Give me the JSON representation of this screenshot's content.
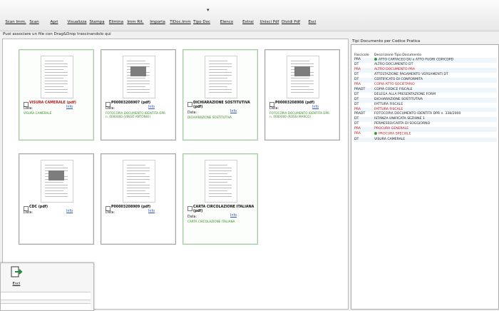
{
  "toolbar": {
    "buttons": [
      {
        "label": "Scan Imm.",
        "icon": "scanner-icon",
        "color": "#4b6b8a"
      },
      {
        "label": "Scan",
        "icon": "scan-icon",
        "color": "#4b6b8a"
      },
      {
        "label": "Apri",
        "icon": "folder-icon",
        "color": "#e8b23a"
      },
      {
        "label": "Visualizza",
        "icon": "view-icon",
        "color": "#4a8a4a"
      },
      {
        "label": "Stampa",
        "icon": "printer-icon",
        "color": "#5a5a5a"
      },
      {
        "label": "Elimina",
        "icon": "delete-icon",
        "color": "#d22b2b"
      },
      {
        "label": "Imm Rit.",
        "icon": "image-crop-icon",
        "color": "#3a7ab0"
      },
      {
        "label": "Importa",
        "icon": "import-icon",
        "color": "#2f8a3a"
      },
      {
        "label": "TiDoc.Imm",
        "icon": "doc-type-image-icon",
        "color": "#3e9a3e"
      },
      {
        "label": "Tipo Doc",
        "icon": "doc-type-icon",
        "color": "#3e9a3e"
      },
      {
        "label": "Elenco",
        "icon": "list-icon",
        "color": "#2e64b5"
      },
      {
        "label": "Estrai",
        "icon": "extract-icon",
        "color": "#d98a2a"
      },
      {
        "label": "Unisci Pdf",
        "icon": "merge-pdf-icon",
        "color": "#c42424"
      },
      {
        "label": "Dividi Pdf",
        "icon": "split-pdf-icon",
        "color": "#c42424"
      },
      {
        "label": "Esci",
        "icon": "exit-icon",
        "color": "#1f8a3a"
      }
    ],
    "dropdown_glyph": "▾"
  },
  "hint": "Puoi associare un file con Drag&Drop trascinandolo qui",
  "cards": [
    {
      "name": "VISURA CAMERALE (pdf)",
      "date_label": "Data:",
      "info": "Info",
      "desc": [
        "VISURA CAMERALE"
      ],
      "selected": true,
      "red": true
    },
    {
      "name": "P00003208907 (pdf)",
      "date_label": "Data:",
      "info": "Info",
      "desc": [
        "FOTOCOPIA DOCUMENTO IDENTITA DPR",
        "n. 0000000 (VIRGO ANTONIO)"
      ],
      "selected": false,
      "red": false
    },
    {
      "name": "DICHIARAZIONE SOSTITUTIVA (pdf)",
      "date_label": "Data:",
      "info": "Info",
      "desc": [
        "DICHIARAZIONE SOSTITUTIVA"
      ],
      "selected": true,
      "red": false
    },
    {
      "name": "P00003208908 (pdf)",
      "date_label": "Data:",
      "info": "Info",
      "desc": [
        "FOTOCOPIA DOCUMENTO IDENTITA DPR",
        "n. 0000000 (ROSSI MARCO)"
      ],
      "selected": false,
      "red": false
    },
    {
      "name": "CDC (pdf)",
      "date_label": "Data:",
      "info": "Info",
      "desc": [],
      "selected": false,
      "red": false
    },
    {
      "name": "P00003208909 (pdf)",
      "date_label": "Data:",
      "info": "Info",
      "desc": [],
      "selected": false,
      "red": false
    },
    {
      "name": "CARTA CIRCOLAZIONE ITALIANA (pdf)",
      "date_label": "Data:",
      "info": "Info",
      "desc": [
        "CARTA CIRCOLAZIONE ITALIANA"
      ],
      "selected": true,
      "red": false
    }
  ],
  "side": {
    "title": "Tipi Documento per Codice Pratica",
    "headers": [
      "Fascicolo",
      "Descrizione Tipo Documento"
    ],
    "rows": [
      {
        "code": "PRA",
        "desc": "ATTO CARTACEO DU o ATTO FUORI CDP/CDPD",
        "red": false,
        "dot": true
      },
      {
        "code": "DT",
        "desc": "ALTRO DOCUMENTO DT",
        "red": false,
        "dot": false
      },
      {
        "code": "PRA",
        "desc": "ALTRO DOCUMENTO PRA",
        "red": true,
        "dot": false
      },
      {
        "code": "DT",
        "desc": "ATTESTAZIONE PAGAMENTO VERSAMENTI DT",
        "red": false,
        "dot": false
      },
      {
        "code": "DT",
        "desc": "CERTIFICATO DI CONFORMITA",
        "red": false,
        "dot": false
      },
      {
        "code": "PRA",
        "desc": "COPIA ATTO SOCIETARIO",
        "red": true,
        "dot": false
      },
      {
        "code": "PRADT",
        "desc": "COPIA CODICE FISCALE",
        "red": false,
        "dot": false
      },
      {
        "code": "DT",
        "desc": "DELEGA ALLA PRESENTAZIONE FORM",
        "red": false,
        "dot": false
      },
      {
        "code": "DT",
        "desc": "DICHIARAZIONE SOSTITUTIVA",
        "red": false,
        "dot": false
      },
      {
        "code": "DT",
        "desc": "FATTURA FISCALE",
        "red": false,
        "dot": false
      },
      {
        "code": "PRA",
        "desc": "FATTURA FISCALE",
        "red": true,
        "dot": false
      },
      {
        "code": "PRADT",
        "desc": "FOTOCOPIA DOCUMENTO IDENTITA DPR n. 338/2000",
        "red": false,
        "dot": false
      },
      {
        "code": "DT",
        "desc": "ISTANZA UNIFICATA SEZIONE 1",
        "red": false,
        "dot": false
      },
      {
        "code": "DT",
        "desc": "PERMESSO/CARTA DI SOGGIORNO",
        "red": false,
        "dot": false
      },
      {
        "code": "PRA",
        "desc": "PROCURA GENERALE",
        "red": true,
        "dot": false
      },
      {
        "code": "PRA",
        "desc": "PROCURA SPECIALE",
        "red": true,
        "dot": true
      },
      {
        "code": "DT",
        "desc": "VISURA CAMERALE",
        "red": false,
        "dot": false
      }
    ]
  },
  "subwindow": {
    "exit_label": "Esci"
  }
}
